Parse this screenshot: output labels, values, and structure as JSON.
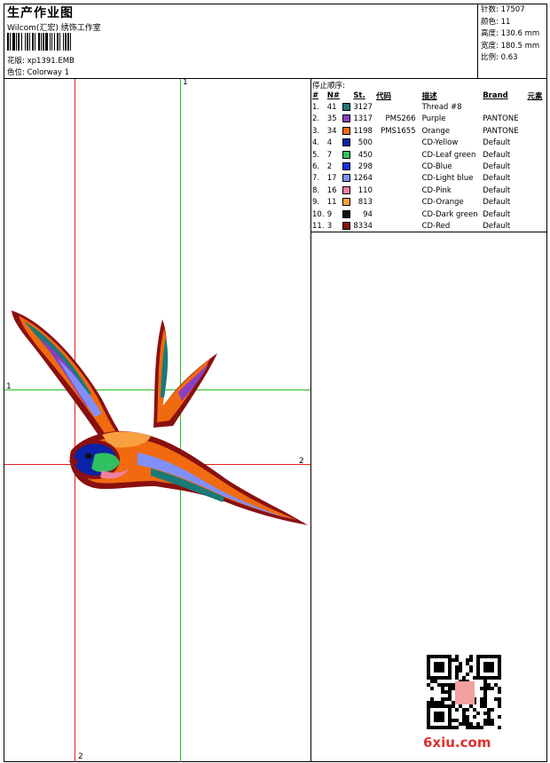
{
  "header": {
    "title": "生产作业图",
    "company": "Wilcom(汇宏) 绣饰工作室",
    "design_label": "花版:",
    "design_value": "xp1391.EMB",
    "colorway_label": "色位:",
    "colorway_value": "Colorway 1"
  },
  "stats": {
    "stitches_label": "针数:",
    "stitches_value": "17507",
    "colors_label": "颜色:",
    "colors_value": "11",
    "height_label": "高度:",
    "height_value": "130.6 mm",
    "width_label": "宽度:",
    "width_value": "180.5 mm",
    "scale_label": "比例:",
    "scale_value": "0.63"
  },
  "thread_table": {
    "stop_sequence_label": "停止顺序:",
    "columns": [
      "#",
      "N#",
      "St.",
      "代码",
      "描述",
      "Brand",
      "元素"
    ],
    "rows": [
      {
        "idx": "1.",
        "n": "41",
        "color": "#1a7a78",
        "st": "3127",
        "code": "",
        "desc": "Thread #8",
        "brand": "",
        "element": ""
      },
      {
        "idx": "2.",
        "n": "35",
        "color": "#8a3ec0",
        "st": "1317",
        "code": "PMS266",
        "desc": "Purple",
        "brand": "PANTONE",
        "element": ""
      },
      {
        "idx": "3.",
        "n": "34",
        "color": "#f06a10",
        "st": "1198",
        "code": "PMS1655",
        "desc": "Orange",
        "brand": "PANTONE",
        "element": ""
      },
      {
        "idx": "4.",
        "n": "4",
        "color": "#0a22a8",
        "st": "500",
        "code": "",
        "desc": "CD-Yellow",
        "brand": "Default",
        "element": ""
      },
      {
        "idx": "5.",
        "n": "7",
        "color": "#30c060",
        "st": "450",
        "code": "",
        "desc": "CD-Leaf green",
        "brand": "Default",
        "element": ""
      },
      {
        "idx": "6.",
        "n": "2",
        "color": "#1030f0",
        "st": "298",
        "code": "",
        "desc": "CD-Blue",
        "brand": "Default",
        "element": ""
      },
      {
        "idx": "7.",
        "n": "17",
        "color": "#8090f8",
        "st": "1264",
        "code": "",
        "desc": "CD-Light blue",
        "brand": "Default",
        "element": ""
      },
      {
        "idx": "8.",
        "n": "16",
        "color": "#f080a0",
        "st": "110",
        "code": "",
        "desc": "CD-Pink",
        "brand": "Default",
        "element": ""
      },
      {
        "idx": "9.",
        "n": "11",
        "color": "#f8a040",
        "st": "813",
        "code": "",
        "desc": "CD-Orange",
        "brand": "Default",
        "element": ""
      },
      {
        "idx": "10.",
        "n": "9",
        "color": "#101010",
        "st": "94",
        "code": "",
        "desc": "CD-Dark green",
        "brand": "Default",
        "element": ""
      },
      {
        "idx": "11.",
        "n": "3",
        "color": "#8a1010",
        "st": "8334",
        "code": "",
        "desc": "CD-Red",
        "brand": "Default",
        "element": ""
      }
    ]
  },
  "guides": {
    "red_v_label": "2",
    "green_v_label": "1",
    "green_h_label": "1",
    "red_h_label": "2"
  },
  "watermark": {
    "text": "6xiu.com"
  }
}
